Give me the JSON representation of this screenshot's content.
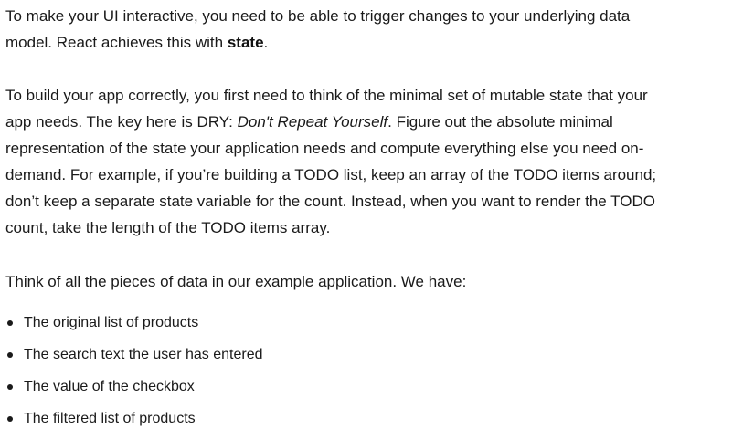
{
  "para1": {
    "text_before": "To make your UI interactive, you need to be able to trigger changes to your underlying data model. React achieves this with ",
    "bold": "state",
    "text_after": "."
  },
  "para2": {
    "text_before": "To build your app correctly, you first need to think of the minimal set of mutable state that your app needs. The key here is ",
    "link_prefix": "DRY: ",
    "link_italic": "Don't Repeat Yourself",
    "text_after": ". Figure out the absolute minimal representation of the state your application needs and compute everything else you need on-demand. For example, if you’re building a TODO list, keep an array of the TODO items around; don’t keep a separate state variable for the count. Instead, when you want to render the TODO count, take the length of the TODO items array."
  },
  "para3": {
    "text": "Think of all the pieces of data in our example application. We have:"
  },
  "list": {
    "items": [
      "The original list of products",
      "The search text the user has entered",
      "The value of the checkbox",
      "The filtered list of products"
    ]
  },
  "colors": {
    "link_underline": "#5b9bd5",
    "text": "#1a1a1a"
  }
}
